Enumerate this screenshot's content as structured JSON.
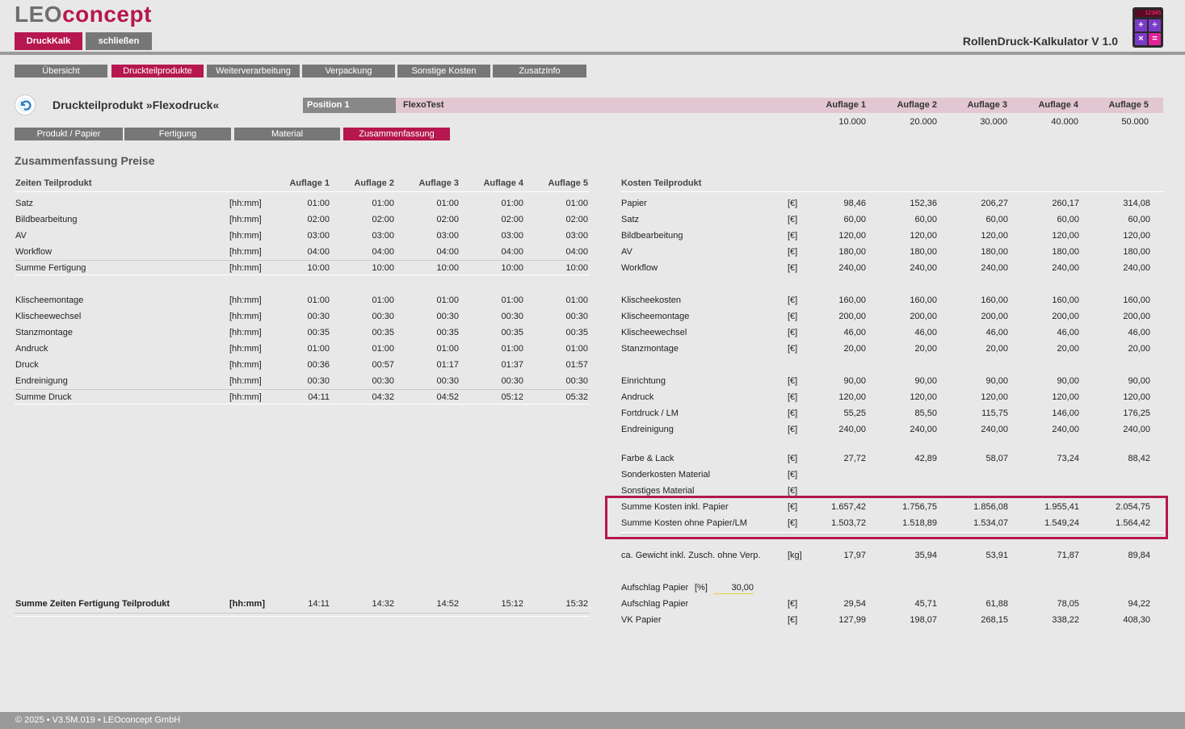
{
  "header": {
    "logo_leo": "LEO",
    "logo_concept": "concept",
    "btn_druckkalk": "DruckKalk",
    "btn_schliessen": "schließen",
    "app_title": "RollenDruck-Kalkulator V 1.0",
    "calc_screen": "12345",
    "colors": {
      "accent": "#b5174e",
      "tab": "#777777",
      "rule": "#9a9a9a"
    }
  },
  "nav": {
    "tabs": [
      "Übersicht",
      "Druckteilprodukte",
      "Weiterverarbeitung",
      "Verpackung",
      "Sonstige Kosten",
      "ZusatzInfo"
    ],
    "active": "Druckteilprodukte"
  },
  "product": {
    "title": "Druckteilprodukt »Flexodruck«",
    "position_label": "Position 1",
    "position_name": "FlexoTest",
    "auflagen_headers": [
      "Auflage 1",
      "Auflage 2",
      "Auflage 3",
      "Auflage 4",
      "Auflage 5"
    ],
    "auflagen_values": [
      "10.000",
      "20.000",
      "30.000",
      "40.000",
      "50.000"
    ]
  },
  "subtabs": {
    "items": [
      "Produkt / Papier",
      "Fertigung",
      "Material",
      "Zusammenfassung"
    ],
    "active": "Zusammenfassung"
  },
  "summary": {
    "title": "Zusammenfassung Preise",
    "zeiten": {
      "heading": "Zeiten Teilprodukt",
      "columns": [
        "Auflage 1",
        "Auflage 2",
        "Auflage 3",
        "Auflage 4",
        "Auflage 5"
      ],
      "group1": [
        {
          "label": "Satz",
          "unit": "[hh:mm]",
          "values": [
            "01:00",
            "01:00",
            "01:00",
            "01:00",
            "01:00"
          ]
        },
        {
          "label": "Bildbearbeitung",
          "unit": "[hh:mm]",
          "values": [
            "02:00",
            "02:00",
            "02:00",
            "02:00",
            "02:00"
          ]
        },
        {
          "label": "AV",
          "unit": "[hh:mm]",
          "values": [
            "03:00",
            "03:00",
            "03:00",
            "03:00",
            "03:00"
          ]
        },
        {
          "label": "Workflow",
          "unit": "[hh:mm]",
          "values": [
            "04:00",
            "04:00",
            "04:00",
            "04:00",
            "04:00"
          ]
        },
        {
          "label": "Summe Fertigung",
          "unit": "[hh:mm]",
          "values": [
            "10:00",
            "10:00",
            "10:00",
            "10:00",
            "10:00"
          ]
        }
      ],
      "group2": [
        {
          "label": "Klischeemontage",
          "unit": "[hh:mm]",
          "values": [
            "01:00",
            "01:00",
            "01:00",
            "01:00",
            "01:00"
          ]
        },
        {
          "label": "Klischeewechsel",
          "unit": "[hh:mm]",
          "values": [
            "00:30",
            "00:30",
            "00:30",
            "00:30",
            "00:30"
          ]
        },
        {
          "label": "Stanzmontage",
          "unit": "[hh:mm]",
          "values": [
            "00:35",
            "00:35",
            "00:35",
            "00:35",
            "00:35"
          ]
        },
        {
          "label": "Andruck",
          "unit": "[hh:mm]",
          "values": [
            "01:00",
            "01:00",
            "01:00",
            "01:00",
            "01:00"
          ]
        },
        {
          "label": "Druck",
          "unit": "[hh:mm]",
          "values": [
            "00:36",
            "00:57",
            "01:17",
            "01:37",
            "01:57"
          ]
        },
        {
          "label": "Endreinigung",
          "unit": "[hh:mm]",
          "values": [
            "00:30",
            "00:30",
            "00:30",
            "00:30",
            "00:30"
          ]
        },
        {
          "label": "Summe Druck",
          "unit": "[hh:mm]",
          "values": [
            "04:11",
            "04:32",
            "04:52",
            "05:12",
            "05:32"
          ]
        }
      ],
      "total": {
        "label": "Summe Zeiten Fertigung Teilprodukt",
        "unit": "[hh:mm]",
        "values": [
          "14:11",
          "14:32",
          "14:52",
          "15:12",
          "15:32"
        ]
      }
    },
    "kosten": {
      "heading": "Kosten Teilprodukt",
      "group1": [
        {
          "label": "Papier",
          "unit": "[€]",
          "values": [
            "98,46",
            "152,36",
            "206,27",
            "260,17",
            "314,08"
          ]
        },
        {
          "label": "Satz",
          "unit": "[€]",
          "values": [
            "60,00",
            "60,00",
            "60,00",
            "60,00",
            "60,00"
          ]
        },
        {
          "label": "Bildbearbeitung",
          "unit": "[€]",
          "values": [
            "120,00",
            "120,00",
            "120,00",
            "120,00",
            "120,00"
          ]
        },
        {
          "label": "AV",
          "unit": "[€]",
          "values": [
            "180,00",
            "180,00",
            "180,00",
            "180,00",
            "180,00"
          ]
        },
        {
          "label": "Workflow",
          "unit": "[€]",
          "values": [
            "240,00",
            "240,00",
            "240,00",
            "240,00",
            "240,00"
          ]
        }
      ],
      "group2": [
        {
          "label": "Klischeekosten",
          "unit": "[€]",
          "values": [
            "160,00",
            "160,00",
            "160,00",
            "160,00",
            "160,00"
          ]
        },
        {
          "label": "Klischeemontage",
          "unit": "[€]",
          "values": [
            "200,00",
            "200,00",
            "200,00",
            "200,00",
            "200,00"
          ]
        },
        {
          "label": "Klischeewechsel",
          "unit": "[€]",
          "values": [
            "46,00",
            "46,00",
            "46,00",
            "46,00",
            "46,00"
          ]
        },
        {
          "label": "Stanzmontage",
          "unit": "[€]",
          "values": [
            "20,00",
            "20,00",
            "20,00",
            "20,00",
            "20,00"
          ]
        }
      ],
      "group3": [
        {
          "label": "Einrichtung",
          "unit": "[€]",
          "values": [
            "90,00",
            "90,00",
            "90,00",
            "90,00",
            "90,00"
          ]
        },
        {
          "label": "Andruck",
          "unit": "[€]",
          "values": [
            "120,00",
            "120,00",
            "120,00",
            "120,00",
            "120,00"
          ]
        },
        {
          "label": "Fortdruck / LM",
          "unit": "[€]",
          "values": [
            "55,25",
            "85,50",
            "115,75",
            "146,00",
            "176,25"
          ]
        },
        {
          "label": "Endreinigung",
          "unit": "[€]",
          "values": [
            "240,00",
            "240,00",
            "240,00",
            "240,00",
            "240,00"
          ]
        }
      ],
      "group4": [
        {
          "label": "Farbe & Lack",
          "unit": "[€]",
          "values": [
            "27,72",
            "42,89",
            "58,07",
            "73,24",
            "88,42"
          ]
        },
        {
          "label": "Sonderkosten Material",
          "unit": "[€]",
          "values": [
            "",
            "",
            "",
            "",
            ""
          ]
        },
        {
          "label": "Sonstiges Material",
          "unit": "[€]",
          "values": [
            "",
            "",
            "",
            "",
            ""
          ]
        }
      ],
      "sums": [
        {
          "label": "Summe Kosten inkl. Papier",
          "unit": "[€]",
          "values": [
            "1.657,42",
            "1.756,75",
            "1.856,08",
            "1.955,41",
            "2.054,75"
          ]
        },
        {
          "label": "Summe Kosten ohne Papier/LM",
          "unit": "[€]",
          "values": [
            "1.503,72",
            "1.518,89",
            "1.534,07",
            "1.549,24",
            "1.564,42"
          ]
        }
      ],
      "gewicht": {
        "label": "ca. Gewicht inkl. Zusch. ohne Verp.",
        "unit": "[kg]",
        "values": [
          "17,97",
          "35,94",
          "53,91",
          "71,87",
          "89,84"
        ]
      },
      "aufschlag_label": "Aufschlag Papier",
      "aufschlag_unit": "[%]",
      "aufschlag_value": "30,00",
      "aufschlag_rows": [
        {
          "label": "Aufschlag Papier",
          "unit": "[€]",
          "values": [
            "29,54",
            "45,71",
            "61,88",
            "78,05",
            "94,22"
          ]
        },
        {
          "label": "VK Papier",
          "unit": "[€]",
          "values": [
            "127,99",
            "198,07",
            "268,15",
            "338,22",
            "408,30"
          ]
        }
      ]
    }
  },
  "footer": {
    "text": "© 2025 • V3.5M.019 • LEOconcept GmbH"
  }
}
